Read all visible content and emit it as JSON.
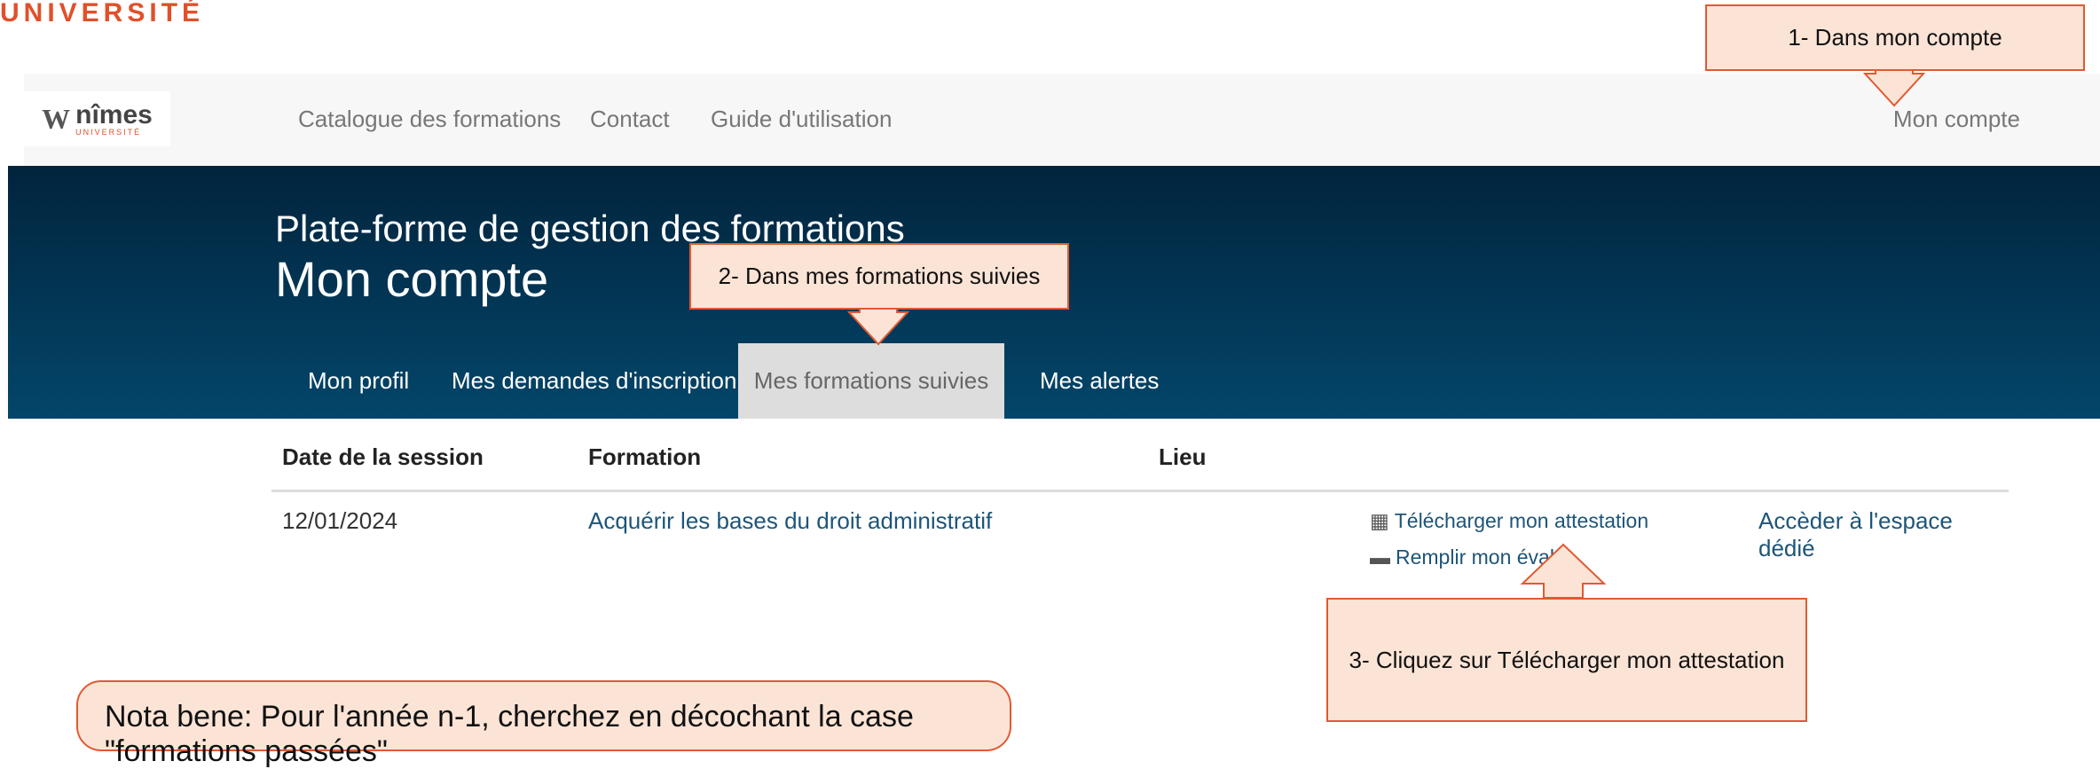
{
  "corner_logo": {
    "text": "UNIVERSITÉ"
  },
  "navbar": {
    "logo": {
      "mark": "W",
      "word": "nîmes",
      "sub": "UNIVERSITÉ"
    },
    "links": [
      "Catalogue des formations",
      "Contact",
      "Guide d'utilisation"
    ],
    "account": "Mon compte"
  },
  "hero": {
    "line1": "Plate-forme de gestion des formations",
    "line2": "Mon compte",
    "tabs": [
      {
        "label": "Mon profil"
      },
      {
        "label": "Mes demandes d'inscription"
      },
      {
        "label": "Mes formations suivies"
      },
      {
        "label": "Mes alertes"
      }
    ]
  },
  "table": {
    "headers": [
      "Date de la session",
      "Formation",
      "Lieu"
    ],
    "rows": [
      {
        "date": "12/01/2024",
        "formation": "Acquérir les bases du droit administratif",
        "lieu": "",
        "download": "Télécharger mon attestation",
        "evaluation": "Remplir mon éval",
        "space": "Accèder à l'espace dédié"
      }
    ]
  },
  "callouts": {
    "step1": "1- Dans mon compte",
    "step2": "2- Dans mes formations suivies",
    "step3": "3- Cliquez sur Télécharger mon attestation"
  },
  "note": {
    "text": "Nota bene: Pour l'année n-1, cherchez en décochant la case \"formations passées\""
  },
  "colors": {
    "accent": "#e05a33",
    "callout_bg": "#fbe4d6",
    "hero_top": "#02243d",
    "hero_bottom": "#03466a",
    "link": "#1d5578"
  }
}
